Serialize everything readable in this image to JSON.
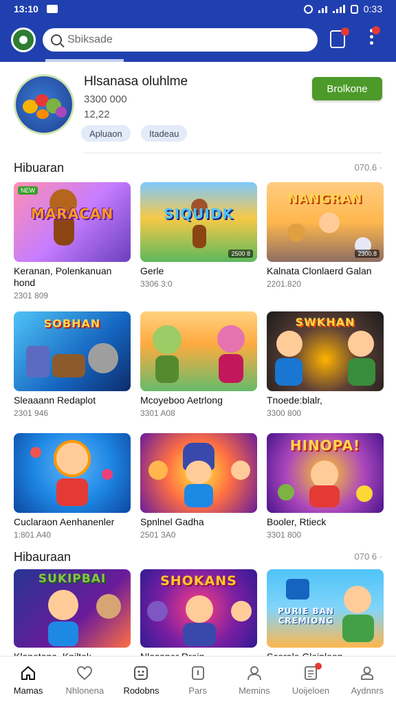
{
  "status_bar": {
    "time": "13:10",
    "battery": "0:33"
  },
  "search": {
    "placeholder": "Sbiksade"
  },
  "profile": {
    "name": "Hlsanasa oluhlme",
    "stat1": "3300 000",
    "stat2": "12,22",
    "chips": [
      "Apluaon",
      "Itadeau"
    ],
    "action_label": "Brolkone"
  },
  "sections": [
    {
      "title": "Hibuaran",
      "more": "070.6 ·",
      "items": [
        {
          "title": "Keranan, Polenkanuan hond",
          "meta": "2301 809",
          "logo": "MARACAN",
          "badge": "",
          "tag": "NEW"
        },
        {
          "title": "Gerle",
          "meta": "3306 3:0",
          "logo": "SIQUIDK",
          "badge": "2500 8",
          "tag": ""
        },
        {
          "title": "Kalnata Clonlaerd Galan",
          "meta": "2201.820",
          "logo": "NANGRAN",
          "badge": "2300.8",
          "tag": ""
        },
        {
          "title": "Sleaaann Redaplot",
          "meta": "2301 946",
          "logo": "SOBHAN",
          "badge": "",
          "tag": ""
        },
        {
          "title": "Mcoyeboo Aetrlong",
          "meta": "3301 A08",
          "logo": "",
          "badge": "",
          "tag": ""
        },
        {
          "title": "Tnoede:blalr,",
          "meta": "3300 800",
          "logo": "SWKHAN",
          "badge": "",
          "tag": ""
        },
        {
          "title": "Cuclaraon Aenhanenler",
          "meta": "1:801 A40",
          "logo": "",
          "badge": "",
          "tag": ""
        },
        {
          "title": "Spnlnel Gadha",
          "meta": "2501 3A0",
          "logo": "",
          "badge": "",
          "tag": ""
        },
        {
          "title": "Booler, Rtieck",
          "meta": "3301 800",
          "logo": "HINOPA!",
          "badge": "",
          "tag": ""
        }
      ]
    },
    {
      "title": "Hibauraan",
      "more": "070 6 ·",
      "items": [
        {
          "title": "Klanetana, Kniltok",
          "logo": "SUKIPBAI"
        },
        {
          "title": "Nlasaner Rrein",
          "logo": "SHOKANS"
        },
        {
          "title": "Scerale Gleiploon",
          "logo": "PURIE BAN CREMIONG"
        }
      ]
    }
  ],
  "bottom_nav": [
    {
      "label": "Mamas",
      "icon": "home-icon"
    },
    {
      "label": "Nhlonena",
      "icon": "heart-badge-icon"
    },
    {
      "label": "Rodobns",
      "icon": "game-icon"
    },
    {
      "label": "Pars",
      "icon": "card-icon"
    },
    {
      "label": "Memins",
      "icon": "person-icon"
    },
    {
      "label": "Uoijeloen",
      "icon": "document-icon"
    },
    {
      "label": "Aydnnrs",
      "icon": "account-icon"
    }
  ],
  "colors": {
    "header": "#2140b0",
    "action_button": "#4c9a2a",
    "badge": "#e53935"
  }
}
